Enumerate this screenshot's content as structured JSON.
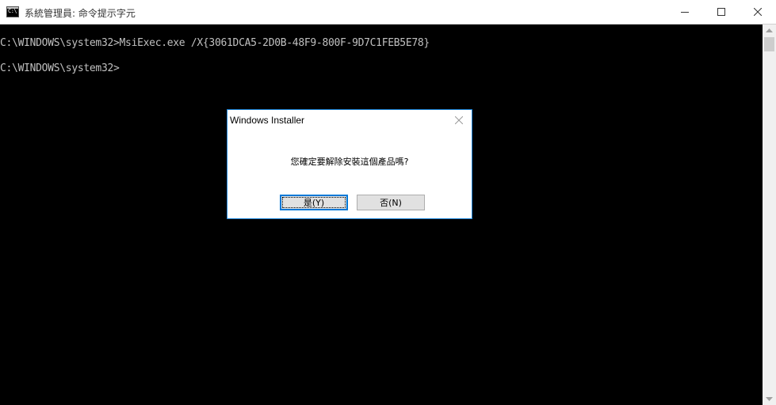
{
  "window": {
    "title": "系統管理員: 命令提示字元",
    "icon": "cmd-icon",
    "icon_glyph": "C:\\"
  },
  "console": {
    "lines": [
      "C:\\WINDOWS\\system32>MsiExec.exe /X{3061DCA5-2D0B-48F9-800F-9D7C1FEB5E78}",
      "C:\\WINDOWS\\system32>"
    ],
    "foreground": "#c0c0c0",
    "background": "#000000"
  },
  "dialog": {
    "title": "Windows Installer",
    "message": "您確定要解除安裝這個產品嗎?",
    "buttons": {
      "yes": "是(Y)",
      "no": "否(N)"
    },
    "accent": "#1883d7"
  }
}
